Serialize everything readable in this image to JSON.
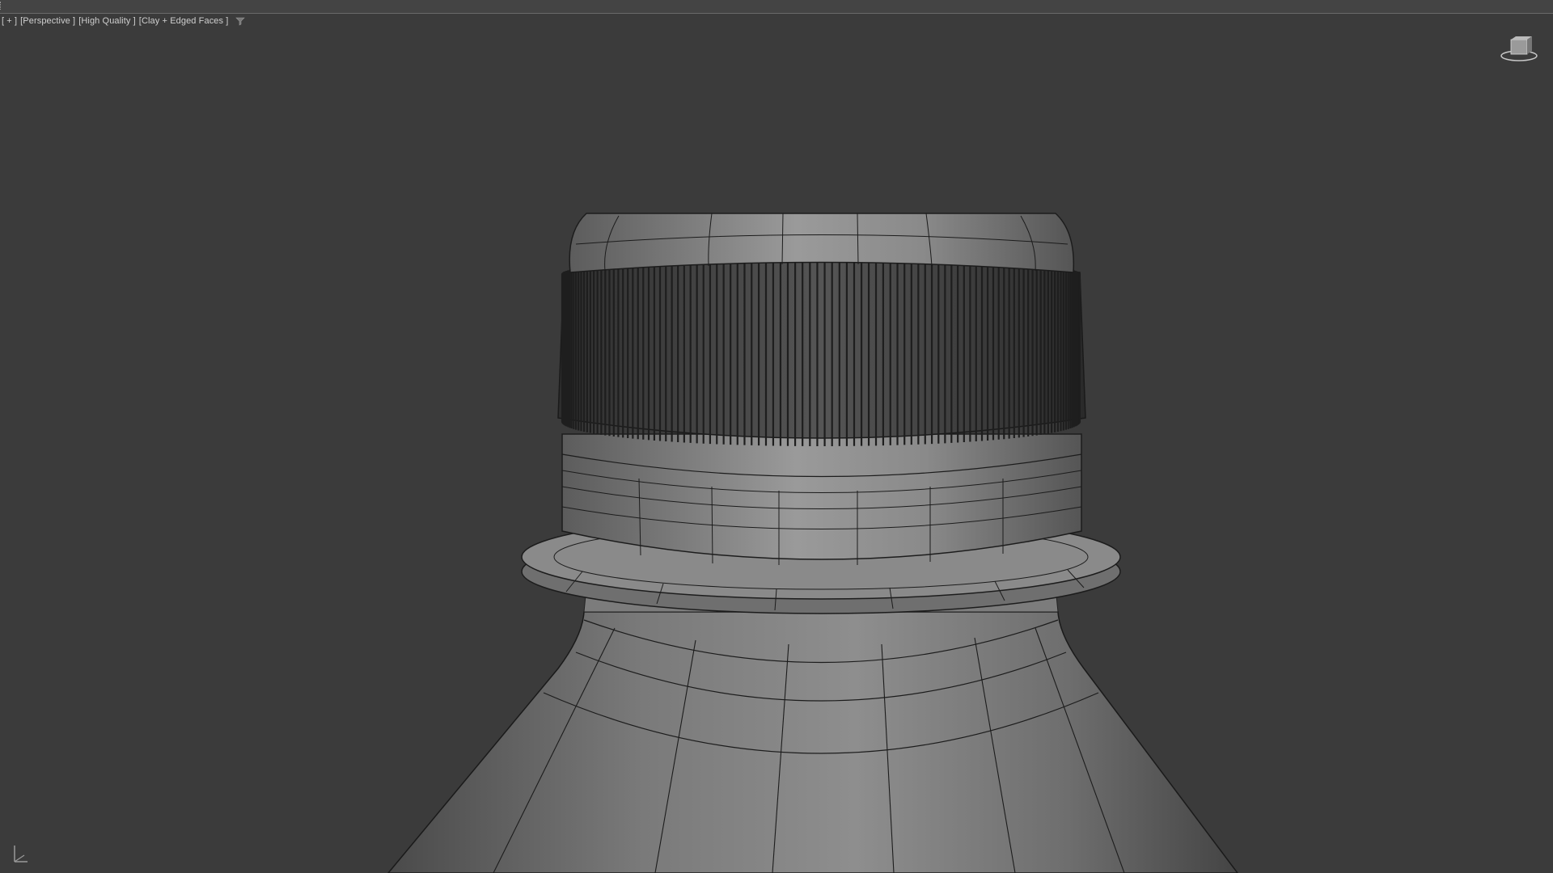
{
  "viewport": {
    "labels": [
      "[ + ]",
      "[Perspective ]",
      "[High Quality ]",
      "[Clay + Edged Faces ]"
    ],
    "filter_icon": "filter-icon",
    "viewcube_icon": "viewcube-icon",
    "axis_icon": "axis-tripod-icon"
  },
  "colors": {
    "background": "#3b3b3b",
    "model_clay": "#8c8c8c",
    "wire": "#1a1a1a"
  }
}
